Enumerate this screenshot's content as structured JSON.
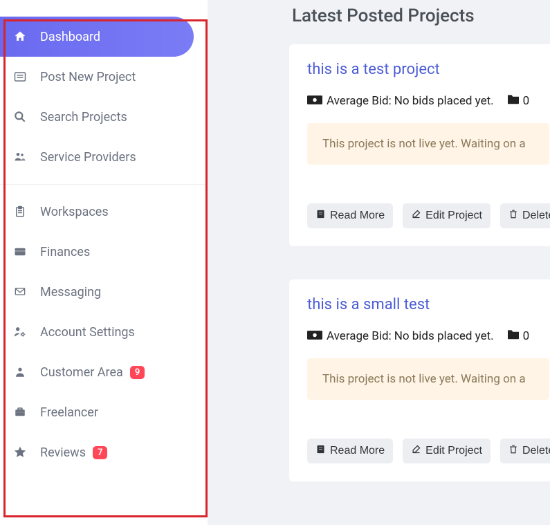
{
  "sidebar": {
    "items": [
      {
        "label": "Dashboard",
        "icon": "home",
        "active": true
      },
      {
        "label": "Post New Project",
        "icon": "form"
      },
      {
        "label": "Search Projects",
        "icon": "search"
      },
      {
        "label": "Service Providers",
        "icon": "users"
      }
    ],
    "items2": [
      {
        "label": "Workspaces",
        "icon": "clipboard"
      },
      {
        "label": "Finances",
        "icon": "wallet"
      },
      {
        "label": "Messaging",
        "icon": "envelope"
      },
      {
        "label": "Account Settings",
        "icon": "user-cog"
      },
      {
        "label": "Customer Area",
        "icon": "user",
        "badge": "9"
      },
      {
        "label": "Freelancer",
        "icon": "briefcase"
      },
      {
        "label": "Reviews",
        "icon": "star",
        "badge": "7"
      }
    ]
  },
  "main": {
    "title": "Latest Posted Projects",
    "projects": [
      {
        "title": "this is a test project",
        "avg_label": "Average Bid:",
        "avg_value": "No bids placed yet.",
        "folder_count": "0",
        "notice": "This project is not live yet. Waiting on a",
        "btn_read": "Read More",
        "btn_edit": "Edit Project",
        "btn_delete": "Delete"
      },
      {
        "title": "this is a small test",
        "avg_label": "Average Bid:",
        "avg_value": "No bids placed yet.",
        "folder_count": "0",
        "notice": "This project is not live yet. Waiting on a",
        "btn_read": "Read More",
        "btn_edit": "Edit Project",
        "btn_delete": "Delete"
      }
    ]
  }
}
